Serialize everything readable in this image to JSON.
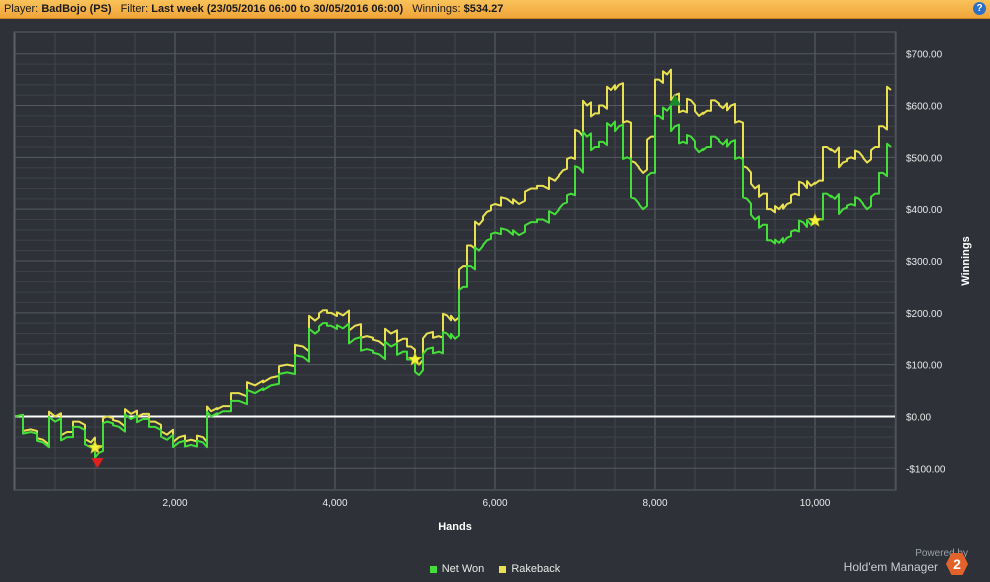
{
  "header": {
    "player_label": "Player:",
    "player_value": "BadBojo (PS)",
    "filter_label": "Filter:",
    "filter_value": "Last week (23/05/2016 06:00 to 30/05/2016 06:00)",
    "winnings_label": "Winnings:",
    "winnings_value": "$534.27",
    "help_icon": "?"
  },
  "colors": {
    "background": "#2e3238",
    "net_won": "#44dd3a",
    "rakeback": "#e8e050",
    "zero_line": "#ffffff",
    "accent_bar": "#f4b24a"
  },
  "chart_data": {
    "type": "line",
    "xlabel": "Hands",
    "ylabel": "Winnings",
    "xlim": [
      0,
      11000
    ],
    "ylim": [
      -140,
      740
    ],
    "x_ticks": [
      2000,
      4000,
      6000,
      8000,
      10000
    ],
    "x_tick_labels": [
      "2,000",
      "4,000",
      "6,000",
      "8,000",
      "10,000"
    ],
    "y_ticks": [
      700,
      600,
      500,
      400,
      300,
      200,
      100,
      0,
      -100
    ],
    "y_tick_labels": [
      "$700.00",
      "$600.00",
      "$500.00",
      "$400.00",
      "$300.00",
      "$200.00",
      "$100.00",
      "$0.00",
      "-$100.00"
    ],
    "grid": true,
    "legend_position": "bottom",
    "series": [
      {
        "name": "Net Won",
        "x": [
          0,
          200,
          350,
          500,
          650,
          800,
          950,
          1050,
          1150,
          1300,
          1450,
          1600,
          1750,
          1900,
          2050,
          2200,
          2350,
          2450,
          2600,
          2800,
          3000,
          3200,
          3400,
          3600,
          3750,
          3850,
          3950,
          4100,
          4250,
          4400,
          4550,
          4700,
          4850,
          4950,
          5050,
          5150,
          5300,
          5400,
          5500,
          5600,
          5700,
          5800,
          5900,
          6000,
          6150,
          6300,
          6450,
          6600,
          6750,
          6850,
          6950,
          7050,
          7150,
          7250,
          7350,
          7450,
          7550,
          7650,
          7750,
          7850,
          7950,
          8050,
          8150,
          8250,
          8350,
          8450,
          8550,
          8650,
          8750,
          8850,
          8950,
          9050,
          9150,
          9250,
          9350,
          9450,
          9550,
          9650,
          9750,
          9850,
          9950,
          10050,
          10150,
          10250,
          10350,
          10450,
          10550,
          10650,
          10750,
          10850,
          10950
        ],
        "y": [
          0,
          -30,
          -50,
          -10,
          -40,
          -20,
          -60,
          -70,
          -10,
          -20,
          -5,
          -5,
          -20,
          -45,
          -50,
          -55,
          -50,
          0,
          10,
          30,
          45,
          60,
          85,
          115,
          160,
          180,
          175,
          170,
          150,
          130,
          120,
          135,
          125,
          110,
          80,
          130,
          125,
          160,
          150,
          250,
          290,
          320,
          340,
          355,
          360,
          350,
          375,
          380,
          390,
          410,
          430,
          480,
          540,
          520,
          530,
          560,
          560,
          500,
          420,
          400,
          470,
          580,
          590,
          560,
          530,
          540,
          510,
          520,
          540,
          525,
          530,
          500,
          420,
          380,
          370,
          340,
          335,
          345,
          360,
          375,
          370,
          380,
          430,
          420,
          400,
          410,
          420,
          400,
          430,
          470,
          520
        ],
        "end_value": 534.27
      },
      {
        "name": "Rakeback",
        "x": [
          0,
          200,
          350,
          500,
          650,
          800,
          950,
          1050,
          1150,
          1300,
          1450,
          1600,
          1750,
          1900,
          2050,
          2200,
          2350,
          2450,
          2600,
          2800,
          3000,
          3200,
          3400,
          3600,
          3750,
          3850,
          3950,
          4100,
          4250,
          4400,
          4550,
          4700,
          4850,
          4950,
          5050,
          5150,
          5300,
          5400,
          5500,
          5600,
          5700,
          5800,
          5900,
          6000,
          6150,
          6300,
          6450,
          6600,
          6750,
          6850,
          6950,
          7050,
          7150,
          7250,
          7350,
          7450,
          7550,
          7650,
          7750,
          7850,
          7950,
          8050,
          8150,
          8250,
          8350,
          8450,
          8550,
          8650,
          8750,
          8850,
          8950,
          9050,
          9150,
          9250,
          9350,
          9450,
          9550,
          9650,
          9750,
          9850,
          9950,
          10050,
          10150,
          10250,
          10350,
          10450,
          10550,
          10650,
          10750,
          10850,
          10950
        ],
        "y": [
          0,
          -25,
          -45,
          0,
          -30,
          -10,
          -50,
          -60,
          0,
          -10,
          5,
          5,
          -10,
          -35,
          -40,
          -45,
          -40,
          10,
          20,
          45,
          60,
          75,
          100,
          135,
          185,
          205,
          200,
          195,
          175,
          155,
          145,
          160,
          150,
          135,
          100,
          160,
          155,
          195,
          185,
          290,
          330,
          370,
          395,
          410,
          420,
          410,
          440,
          445,
          455,
          475,
          500,
          550,
          600,
          585,
          600,
          630,
          640,
          570,
          490,
          470,
          540,
          650,
          660,
          620,
          590,
          610,
          580,
          590,
          610,
          595,
          600,
          570,
          480,
          440,
          430,
          400,
          400,
          410,
          430,
          450,
          445,
          455,
          520,
          510,
          490,
          500,
          510,
          490,
          520,
          560,
          630
        ]
      }
    ],
    "markers": [
      {
        "kind": "star",
        "x": 1000,
        "y": -60
      },
      {
        "kind": "triangle-down",
        "x": 1030,
        "y": -90
      },
      {
        "kind": "star",
        "x": 5000,
        "y": 110
      },
      {
        "kind": "triangle-up",
        "x": 8250,
        "y": 610
      },
      {
        "kind": "star",
        "x": 10000,
        "y": 378
      }
    ]
  },
  "legend": {
    "items": [
      {
        "label": "Net Won",
        "color": "#44dd3a"
      },
      {
        "label": "Rakeback",
        "color": "#e8e050"
      }
    ]
  },
  "branding": {
    "powered_by": "Powered by",
    "product": "Hold'em Manager",
    "logo_text": "2"
  }
}
